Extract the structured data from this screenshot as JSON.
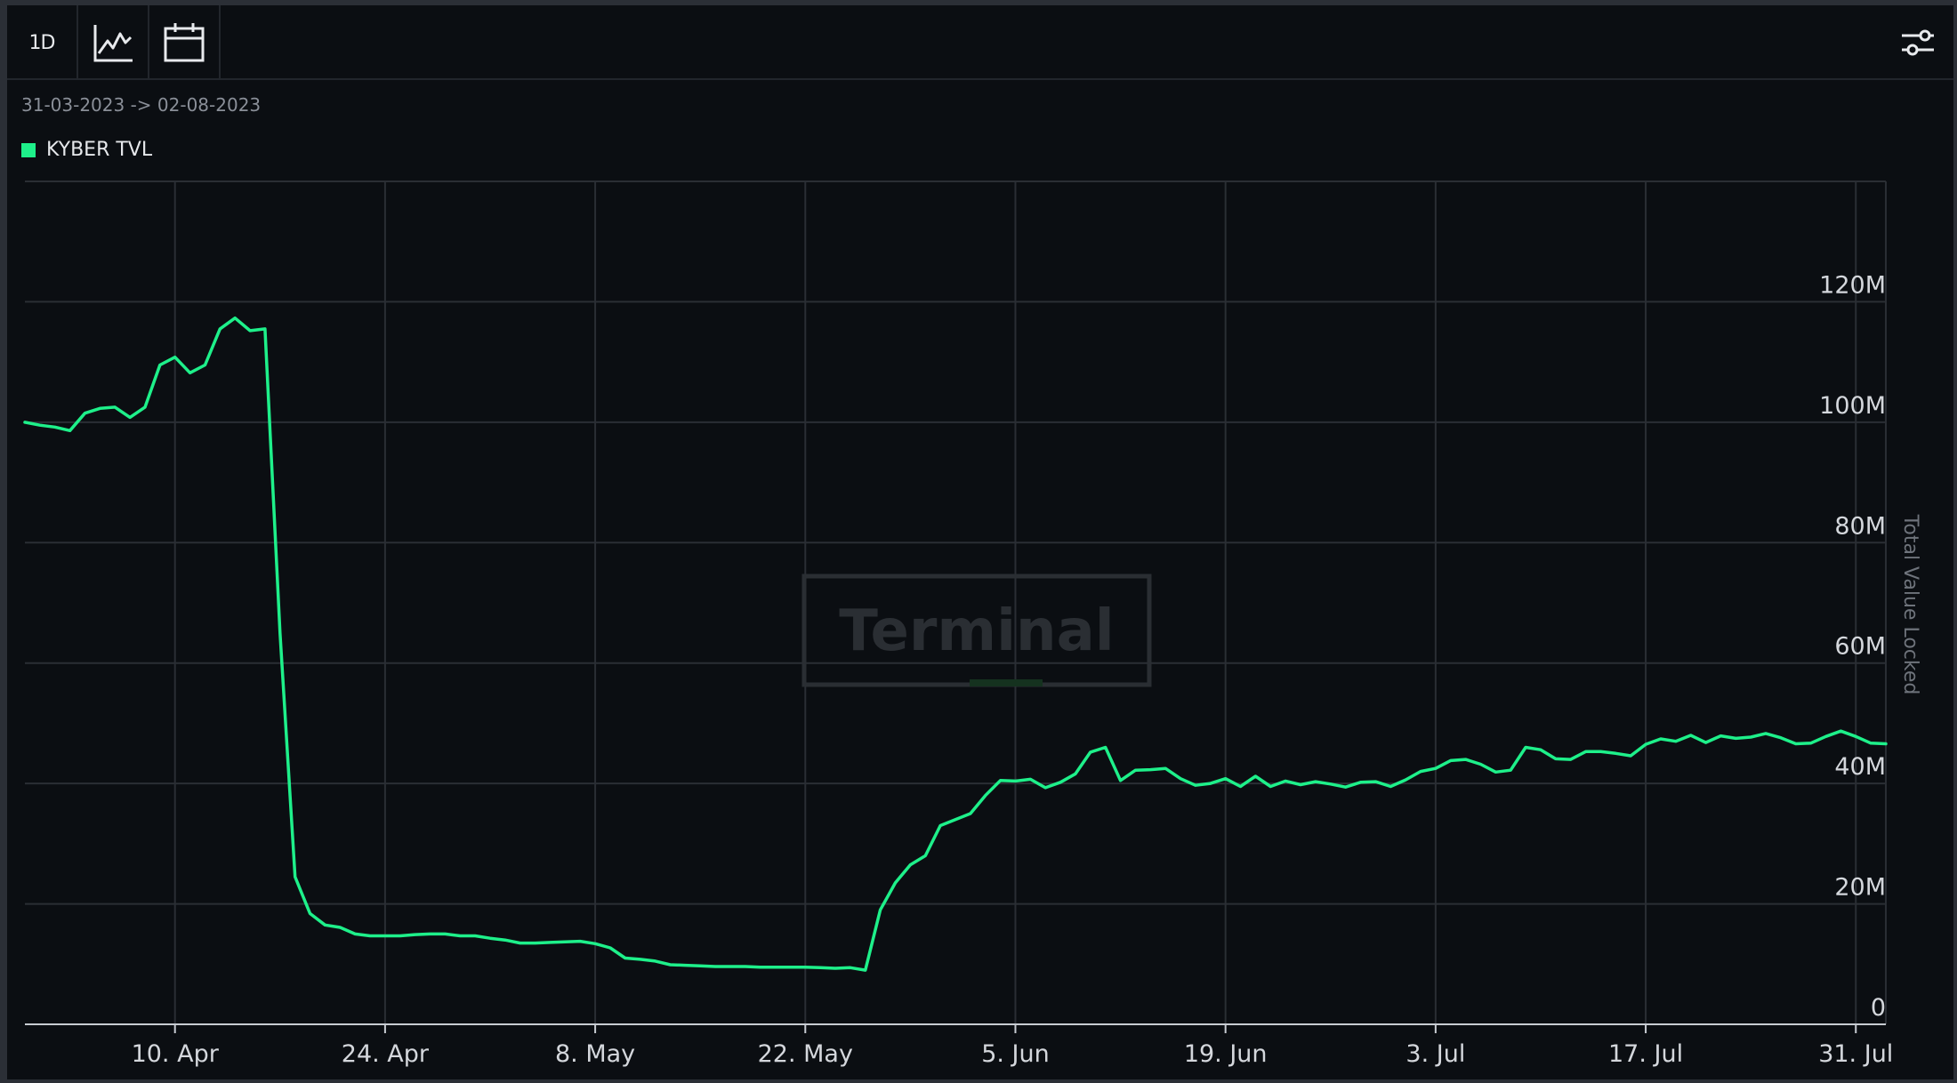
{
  "toolbar": {
    "resolution_label": "1D",
    "line_icon": "line-chart-icon",
    "calendar_icon": "calendar-icon",
    "settings_icon": "sliders-icon"
  },
  "date_range": "31-03-2023 -> 02-08-2023",
  "watermark": "Terminal",
  "colors": {
    "series": "#1ef08a",
    "grid": "#2a2e34",
    "background": "#0b0e12"
  },
  "chart_data": {
    "type": "line",
    "x_start": "2023-03-31",
    "x_end": "2023-08-02",
    "xlim": [
      "2023-03-31",
      "2023-08-02"
    ],
    "ylim": [
      0,
      140000000
    ],
    "ylabel": "Total Value Locked",
    "legend_position": "top-left",
    "grid": true,
    "x_ticks": [
      {
        "date": "2023-04-10",
        "label": "10. Apr"
      },
      {
        "date": "2023-04-24",
        "label": "24. Apr"
      },
      {
        "date": "2023-05-08",
        "label": "8. May"
      },
      {
        "date": "2023-05-22",
        "label": "22. May"
      },
      {
        "date": "2023-06-05",
        "label": "5. Jun"
      },
      {
        "date": "2023-06-19",
        "label": "19. Jun"
      },
      {
        "date": "2023-07-03",
        "label": "3. Jul"
      },
      {
        "date": "2023-07-17",
        "label": "17. Jul"
      },
      {
        "date": "2023-07-31",
        "label": "31. Jul"
      }
    ],
    "y_ticks": [
      {
        "value": 0,
        "label": "0"
      },
      {
        "value": 20000000,
        "label": "20M"
      },
      {
        "value": 40000000,
        "label": "40M"
      },
      {
        "value": 60000000,
        "label": "60M"
      },
      {
        "value": 80000000,
        "label": "80M"
      },
      {
        "value": 100000000,
        "label": "100M"
      },
      {
        "value": 120000000,
        "label": "120M"
      }
    ],
    "series": [
      {
        "name": "KYBER TVL",
        "points": [
          [
            "2023-03-31",
            100000000
          ],
          [
            "2023-04-01",
            99500000
          ],
          [
            "2023-04-02",
            99200000
          ],
          [
            "2023-04-03",
            98600000
          ],
          [
            "2023-04-04",
            101500000
          ],
          [
            "2023-04-05",
            102300000
          ],
          [
            "2023-04-06",
            102500000
          ],
          [
            "2023-04-07",
            100800000
          ],
          [
            "2023-04-08",
            102500000
          ],
          [
            "2023-04-09",
            109500000
          ],
          [
            "2023-04-10",
            110800000
          ],
          [
            "2023-04-11",
            108200000
          ],
          [
            "2023-04-12",
            109500000
          ],
          [
            "2023-04-13",
            115500000
          ],
          [
            "2023-04-14",
            117300000
          ],
          [
            "2023-04-15",
            115200000
          ],
          [
            "2023-04-16",
            115500000
          ],
          [
            "2023-04-17",
            65000000
          ],
          [
            "2023-04-18",
            24500000
          ],
          [
            "2023-04-19",
            18400000
          ],
          [
            "2023-04-20",
            16500000
          ],
          [
            "2023-04-21",
            16100000
          ],
          [
            "2023-04-22",
            15000000
          ],
          [
            "2023-04-23",
            14700000
          ],
          [
            "2023-04-24",
            14700000
          ],
          [
            "2023-04-25",
            14700000
          ],
          [
            "2023-04-26",
            14900000
          ],
          [
            "2023-04-27",
            15000000
          ],
          [
            "2023-04-28",
            15000000
          ],
          [
            "2023-04-29",
            14700000
          ],
          [
            "2023-04-30",
            14700000
          ],
          [
            "2023-05-01",
            14300000
          ],
          [
            "2023-05-02",
            14000000
          ],
          [
            "2023-05-03",
            13500000
          ],
          [
            "2023-05-04",
            13500000
          ],
          [
            "2023-05-05",
            13600000
          ],
          [
            "2023-05-06",
            13700000
          ],
          [
            "2023-05-07",
            13800000
          ],
          [
            "2023-05-08",
            13400000
          ],
          [
            "2023-05-09",
            12700000
          ],
          [
            "2023-05-10",
            11000000
          ],
          [
            "2023-05-11",
            10800000
          ],
          [
            "2023-05-12",
            10500000
          ],
          [
            "2023-05-13",
            9900000
          ],
          [
            "2023-05-14",
            9800000
          ],
          [
            "2023-05-15",
            9700000
          ],
          [
            "2023-05-16",
            9600000
          ],
          [
            "2023-05-17",
            9600000
          ],
          [
            "2023-05-18",
            9600000
          ],
          [
            "2023-05-19",
            9500000
          ],
          [
            "2023-05-20",
            9500000
          ],
          [
            "2023-05-21",
            9500000
          ],
          [
            "2023-05-22",
            9500000
          ],
          [
            "2023-05-23",
            9400000
          ],
          [
            "2023-05-24",
            9300000
          ],
          [
            "2023-05-25",
            9400000
          ],
          [
            "2023-05-26",
            9000000
          ],
          [
            "2023-05-27",
            19000000
          ],
          [
            "2023-05-28",
            23500000
          ],
          [
            "2023-05-29",
            26500000
          ],
          [
            "2023-05-30",
            28000000
          ],
          [
            "2023-05-31",
            33000000
          ],
          [
            "2023-06-01",
            34000000
          ],
          [
            "2023-06-02",
            35000000
          ],
          [
            "2023-06-03",
            38000000
          ],
          [
            "2023-06-04",
            40500000
          ],
          [
            "2023-06-05",
            40400000
          ],
          [
            "2023-06-06",
            40700000
          ],
          [
            "2023-06-07",
            39300000
          ],
          [
            "2023-06-08",
            40200000
          ],
          [
            "2023-06-09",
            41600000
          ],
          [
            "2023-06-10",
            45200000
          ],
          [
            "2023-06-11",
            46000000
          ],
          [
            "2023-06-12",
            40500000
          ],
          [
            "2023-06-13",
            42200000
          ],
          [
            "2023-06-14",
            42300000
          ],
          [
            "2023-06-15",
            42500000
          ],
          [
            "2023-06-16",
            40800000
          ],
          [
            "2023-06-17",
            39700000
          ],
          [
            "2023-06-18",
            40000000
          ],
          [
            "2023-06-19",
            40800000
          ],
          [
            "2023-06-20",
            39500000
          ],
          [
            "2023-06-21",
            41200000
          ],
          [
            "2023-06-22",
            39500000
          ],
          [
            "2023-06-23",
            40400000
          ],
          [
            "2023-06-24",
            39800000
          ],
          [
            "2023-06-25",
            40300000
          ],
          [
            "2023-06-26",
            39900000
          ],
          [
            "2023-06-27",
            39400000
          ],
          [
            "2023-06-28",
            40200000
          ],
          [
            "2023-06-29",
            40300000
          ],
          [
            "2023-06-30",
            39500000
          ],
          [
            "2023-07-01",
            40600000
          ],
          [
            "2023-07-02",
            42000000
          ],
          [
            "2023-07-03",
            42500000
          ],
          [
            "2023-07-04",
            43800000
          ],
          [
            "2023-07-05",
            44000000
          ],
          [
            "2023-07-06",
            43200000
          ],
          [
            "2023-07-07",
            41900000
          ],
          [
            "2023-07-08",
            42200000
          ],
          [
            "2023-07-09",
            46000000
          ],
          [
            "2023-07-10",
            45600000
          ],
          [
            "2023-07-11",
            44100000
          ],
          [
            "2023-07-12",
            44000000
          ],
          [
            "2023-07-13",
            45300000
          ],
          [
            "2023-07-14",
            45300000
          ],
          [
            "2023-07-15",
            45000000
          ],
          [
            "2023-07-16",
            44600000
          ],
          [
            "2023-07-17",
            46500000
          ],
          [
            "2023-07-18",
            47400000
          ],
          [
            "2023-07-19",
            47000000
          ],
          [
            "2023-07-20",
            48000000
          ],
          [
            "2023-07-21",
            46800000
          ],
          [
            "2023-07-22",
            47900000
          ],
          [
            "2023-07-23",
            47500000
          ],
          [
            "2023-07-24",
            47700000
          ],
          [
            "2023-07-25",
            48300000
          ],
          [
            "2023-07-26",
            47600000
          ],
          [
            "2023-07-27",
            46600000
          ],
          [
            "2023-07-28",
            46700000
          ],
          [
            "2023-07-29",
            47800000
          ],
          [
            "2023-07-30",
            48700000
          ],
          [
            "2023-07-31",
            47800000
          ],
          [
            "2023-08-01",
            46700000
          ],
          [
            "2023-08-02",
            46600000
          ]
        ]
      }
    ]
  }
}
